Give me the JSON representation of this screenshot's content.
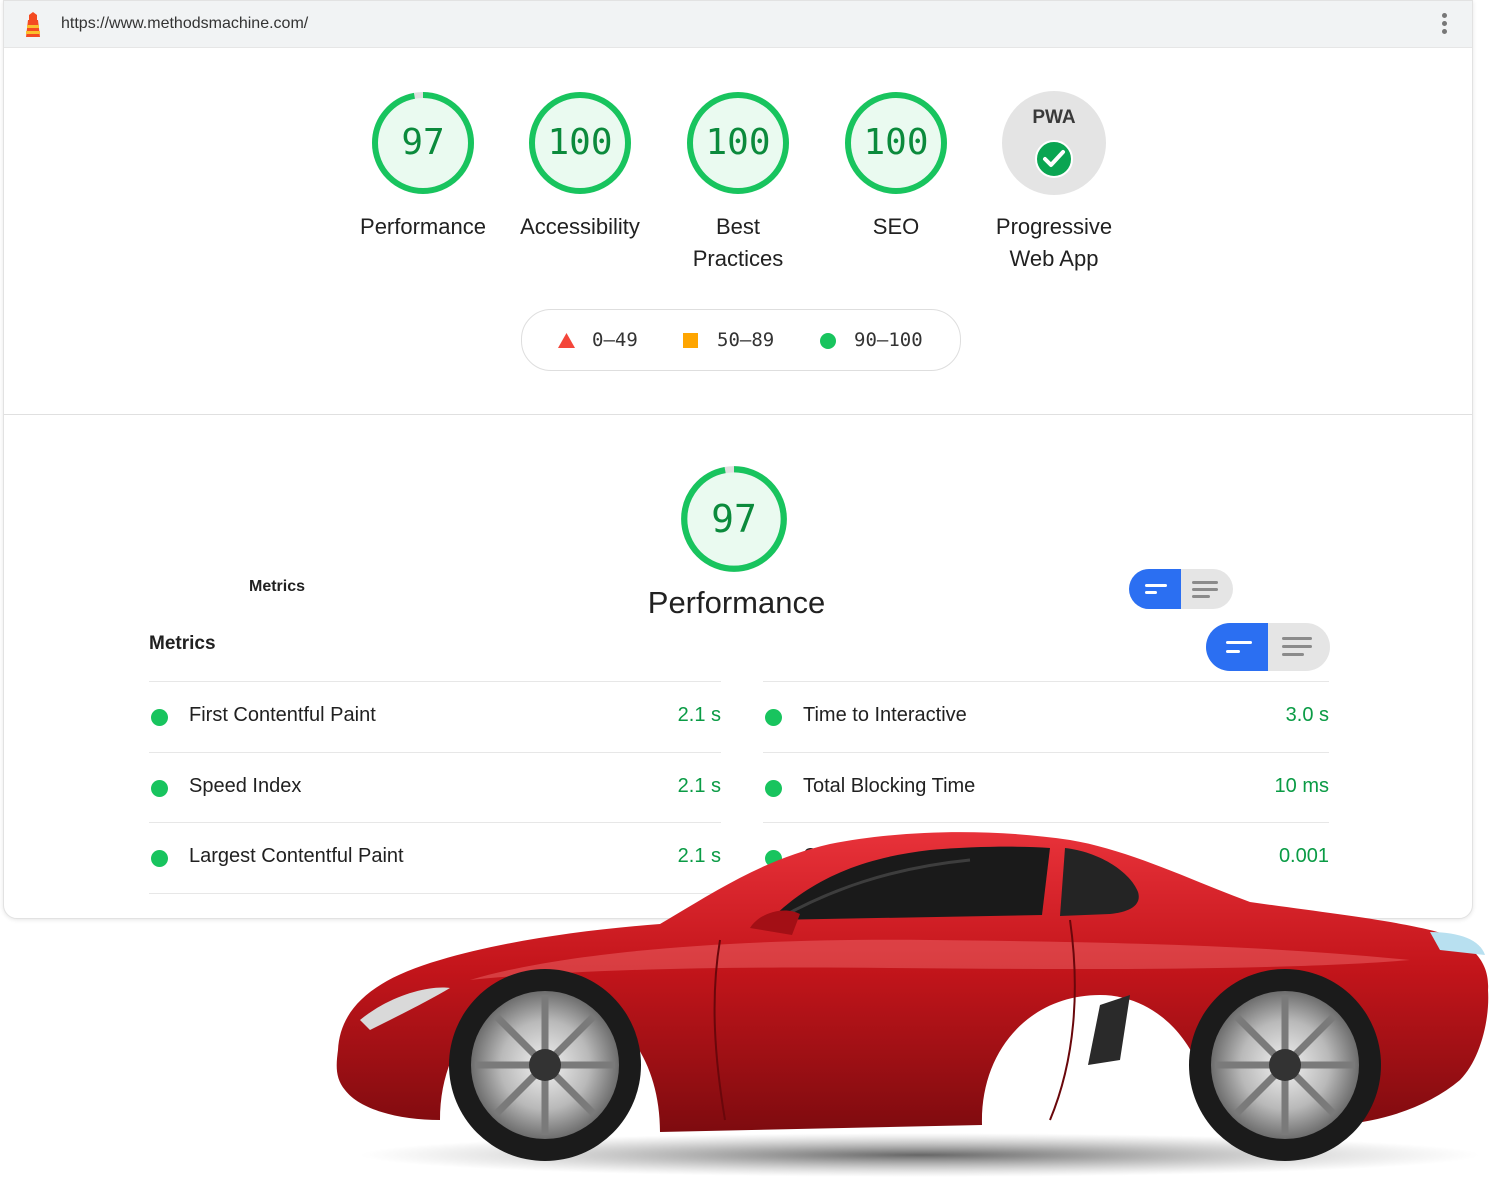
{
  "browser": {
    "url": "https://www.methodsmachine.com/"
  },
  "summary": {
    "gauges": [
      {
        "score": "97",
        "label": "Performance"
      },
      {
        "score": "100",
        "label": "Accessibility"
      },
      {
        "score": "100",
        "label": "Best Practices"
      },
      {
        "score": "100",
        "label": "SEO"
      }
    ],
    "pwa": {
      "badge_text": "PWA",
      "label": "Progressive Web App",
      "icon": "check-icon"
    }
  },
  "legend": [
    {
      "shape": "triangle",
      "color": "#f4463a",
      "range": "0–49"
    },
    {
      "shape": "square",
      "color": "#fea500",
      "range": "50–89"
    },
    {
      "shape": "circle",
      "color": "#18c45e",
      "range": "90–100"
    }
  ],
  "performance": {
    "score": "97",
    "title": "Performance",
    "ghost_heading": "Metrics",
    "metrics_heading": "Metrics",
    "metrics_left": [
      {
        "name": "First Contentful Paint",
        "value": "2.1 s"
      },
      {
        "name": "Speed Index",
        "value": "2.1 s"
      },
      {
        "name": "Largest Contentful Paint",
        "value": "2.1 s"
      }
    ],
    "metrics_right": [
      {
        "name": "Time to Interactive",
        "value": "3.0 s"
      },
      {
        "name": "Total Blocking Time",
        "value": "10 ms"
      },
      {
        "name": "Cumu",
        "value": "0.001"
      }
    ]
  },
  "colors": {
    "pass": "#18c45e",
    "accent": "#2b6ff2",
    "car": "#c4151b"
  }
}
